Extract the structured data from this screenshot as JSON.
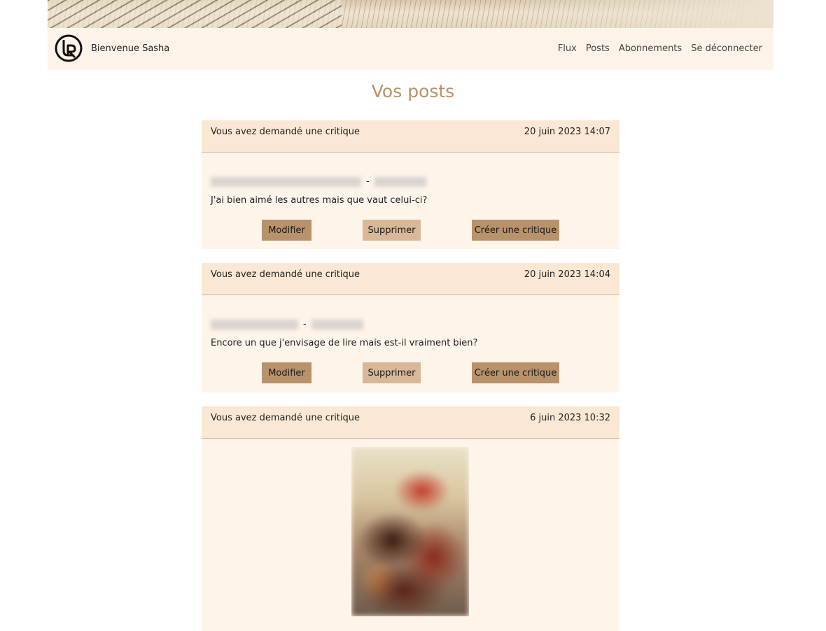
{
  "header": {
    "welcome": "Bienvenue Sasha",
    "nav": [
      "Flux",
      "Posts",
      "Abonnements",
      "Se déconnecter"
    ]
  },
  "page_title": "Vos posts",
  "posts": [
    {
      "label": "Vous avez demandé une critique",
      "date": "20 juin 2023 14:07",
      "separator": "-",
      "description": "J'ai bien aimé les autres mais que vaut celui-ci?",
      "buttons": [
        "Modifier",
        "Supprimer",
        "Créer une critique"
      ]
    },
    {
      "label": "Vous avez demandé une critique",
      "date": "20 juin 2023 14:04",
      "separator": "-",
      "description": "Encore un que j'envisage de lire mais est-il vraiment bien?",
      "buttons": [
        "Modifier",
        "Supprimer",
        "Créer une critique"
      ]
    },
    {
      "label": "Vous avez demandé une critique",
      "date": "6 juin 2023 10:32"
    }
  ],
  "colors": {
    "accent": "#b8926a",
    "button_light": "#d8b898",
    "card_header": "#fbe8d4",
    "card_body": "#fdf4ea"
  }
}
